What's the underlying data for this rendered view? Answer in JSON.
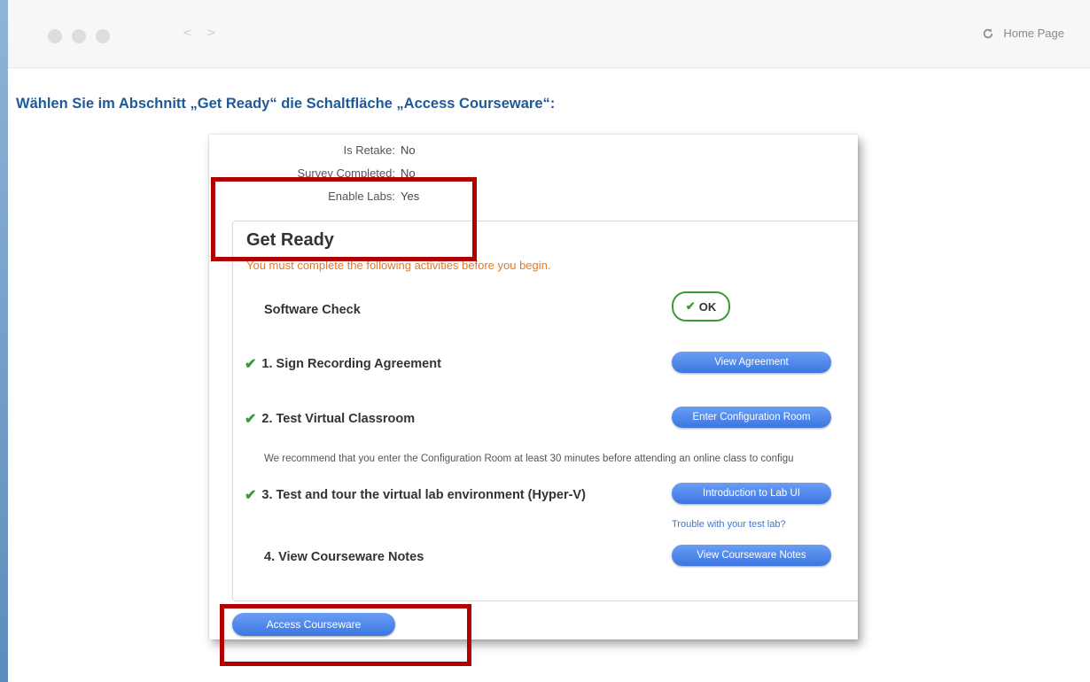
{
  "browser": {
    "nav_arrows": "< >",
    "home_label": "Home Page"
  },
  "instruction": "Wählen Sie im Abschnitt „Get Ready“  die Schaltfläche „Access Courseware“:",
  "info": [
    {
      "key": "Is Retake:",
      "value": "No"
    },
    {
      "key": "Survey Completed:",
      "value": "No"
    },
    {
      "key": "Enable Labs:",
      "value": "Yes"
    }
  ],
  "get_ready": {
    "title": "Get Ready",
    "subtitle": "You must complete the following activities before you begin.",
    "software_check": "Software Check",
    "ok_label": "OK",
    "items": [
      {
        "label": "1. Sign Recording Agreement",
        "button": "View Agreement"
      },
      {
        "label": "2. Test Virtual Classroom",
        "button": "Enter Configuration Room"
      },
      {
        "label": "3. Test and tour the virtual lab environment (Hyper-V)",
        "button": "Introduction to Lab UI"
      },
      {
        "label": "4. View Courseware Notes",
        "button": "View Courseware Notes"
      }
    ],
    "recommend": "We recommend that you enter the Configuration Room at least 30 minutes before attending an online class to configu",
    "trouble_link": "Trouble with your test lab?"
  },
  "access_button": "Access Courseware",
  "colors": {
    "instruction": "#1d5a9c",
    "button": "#3b76e0",
    "highlight": "#b00000",
    "check": "#3a9a3a",
    "subtitle": "#e07a28"
  }
}
